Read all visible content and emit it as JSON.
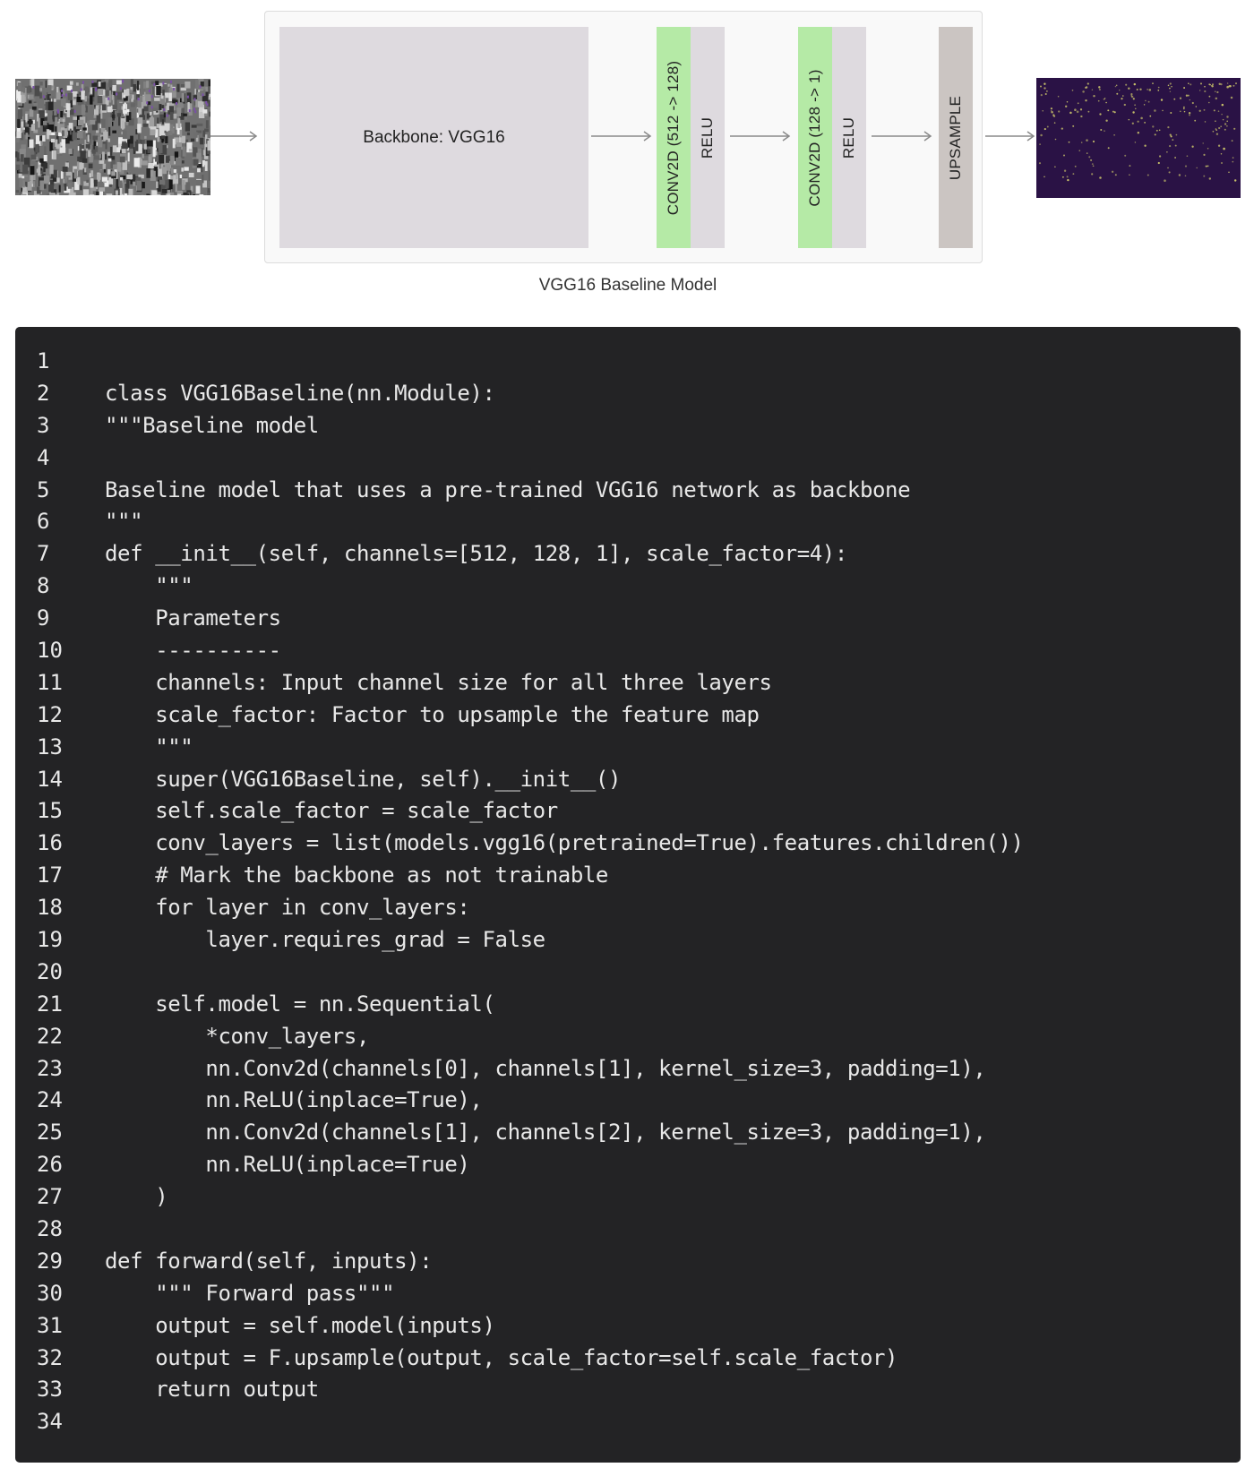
{
  "diagram": {
    "backbone_label": "Backbone: VGG16",
    "conv1_label": "CONV2D (512 -> 128)",
    "relu1_label": "RELU",
    "conv2_label": "CONV2D (128 -> 1)",
    "relu2_label": "RELU",
    "upsample_label": "UPSAMPLE",
    "caption": "VGG16 Baseline Model",
    "colors": {
      "conv": "#b5eaa6",
      "relu": "#dedadf",
      "backbone": "#dedadf",
      "upsample": "#cbc5c2",
      "output_bg": "#2a1245",
      "output_dots": "#c9c36a"
    }
  },
  "code": {
    "language": "python",
    "lines": [
      "",
      "class VGG16Baseline(nn.Module):",
      "\"\"\"Baseline model",
      "",
      "Baseline model that uses a pre-trained VGG16 network as backbone",
      "\"\"\"",
      "def __init__(self, channels=[512, 128, 1], scale_factor=4):",
      "    \"\"\"",
      "    Parameters",
      "    ----------",
      "    channels: Input channel size for all three layers",
      "    scale_factor: Factor to upsample the feature map",
      "    \"\"\"",
      "    super(VGG16Baseline, self).__init__()",
      "    self.scale_factor = scale_factor",
      "    conv_layers = list(models.vgg16(pretrained=True).features.children())",
      "    # Mark the backbone as not trainable",
      "    for layer in conv_layers:",
      "        layer.requires_grad = False",
      "",
      "    self.model = nn.Sequential(",
      "        *conv_layers,",
      "        nn.Conv2d(channels[0], channels[1], kernel_size=3, padding=1),",
      "        nn.ReLU(inplace=True),",
      "        nn.Conv2d(channels[1], channels[2], kernel_size=3, padding=1),",
      "        nn.ReLU(inplace=True)",
      "    )",
      "",
      "def forward(self, inputs):",
      "    \"\"\" Forward pass\"\"\"",
      "    output = self.model(inputs)",
      "    output = F.upsample(output, scale_factor=self.scale_factor)",
      "    return output",
      ""
    ]
  }
}
